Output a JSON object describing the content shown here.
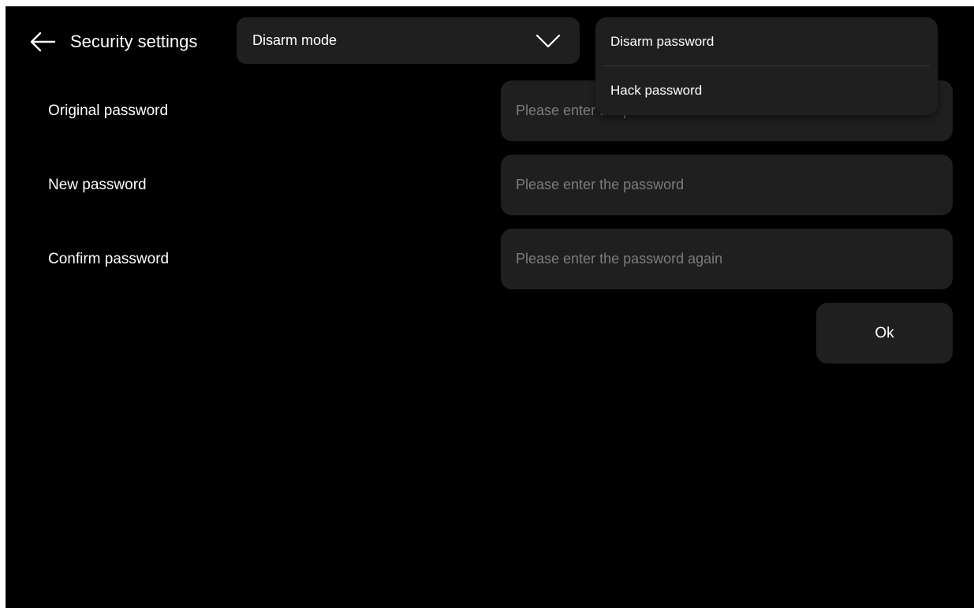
{
  "header": {
    "back_icon": "arrow-left-icon",
    "title": "Security settings"
  },
  "mode_select": {
    "selected": "Disarm mode",
    "icon": "chevron-down-icon"
  },
  "dropdown": {
    "options": [
      {
        "label": "Disarm password"
      },
      {
        "label": "Hack password"
      }
    ]
  },
  "form": {
    "original": {
      "label": "Original password",
      "value": "",
      "placeholder": "Please enter the password"
    },
    "new": {
      "label": "New password",
      "value": "",
      "placeholder": "Please enter the password"
    },
    "confirm": {
      "label": "Confirm password",
      "value": "",
      "placeholder": "Please enter the password again"
    }
  },
  "actions": {
    "ok_label": "Ok"
  },
  "colors": {
    "background": "#000000",
    "surface": "#1f1f1f",
    "text": "#ffffff",
    "placeholder": "#7c7c7c"
  }
}
